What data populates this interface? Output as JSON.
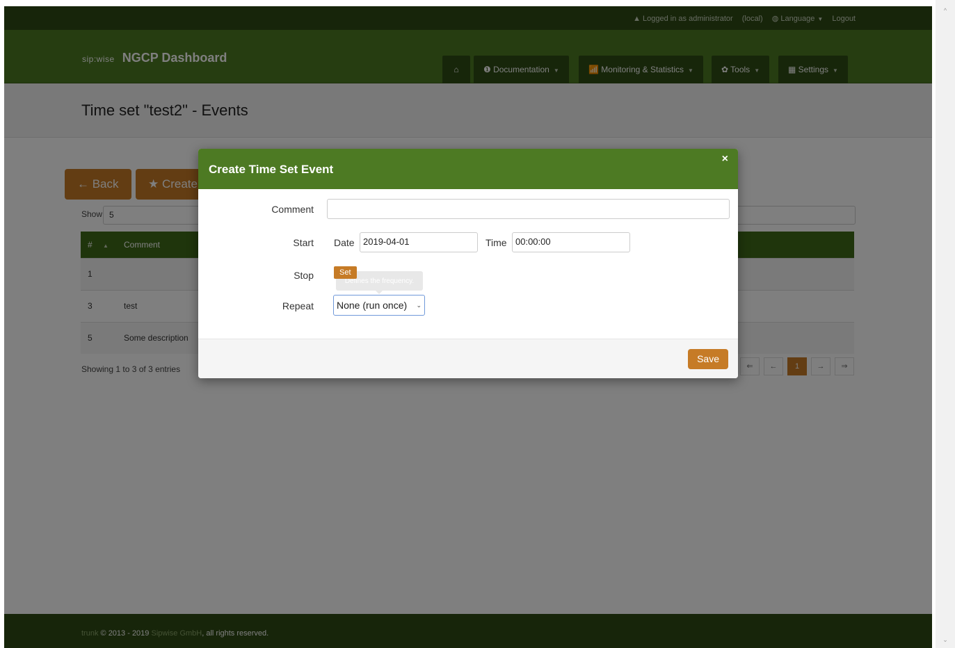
{
  "topbar": {
    "logged_in": "▲ Logged in as administrator",
    "realm": "(local)",
    "language": "◍ Language",
    "logout": "Logout"
  },
  "brand": {
    "logo": "sip:wise",
    "title": "NGCP Dashboard"
  },
  "nav": {
    "home_icon": "home-icon",
    "documentation": "❶ Documentation",
    "monitoring": "📶 Monitoring & Statistics",
    "tools": "✿ Tools",
    "settings": "▦ Settings"
  },
  "header": {
    "title": "Time set \"test2\" - Events"
  },
  "buttons": {
    "back": "← Back",
    "create": "★ Create"
  },
  "table": {
    "show_label": "Show",
    "show_value": "5",
    "columns": [
      "#",
      "Comment"
    ],
    "rows": [
      {
        "id": "1",
        "comment": ""
      },
      {
        "id": "3",
        "comment": "test"
      },
      {
        "id": "5",
        "comment": "Some description"
      }
    ],
    "info": "Showing 1 to 3 of 3 entries",
    "pager": [
      "⇐",
      "←",
      "1",
      "→",
      "⇒"
    ]
  },
  "footer": {
    "trunk": "trunk",
    "copyright": "© 2013 - 2019",
    "company": "Sipwise GmbH",
    "rights": ", all rights reserved."
  },
  "modal": {
    "title": "Create Time Set Event",
    "close": "×",
    "comment_label": "Comment",
    "comment_value": "",
    "start_label": "Start",
    "date_label": "Date",
    "date_value": "2019-04-01",
    "time_label": "Time",
    "time_value": "00:00:00",
    "stop_label": "Stop",
    "set_button": "Set",
    "tooltip": "Defines the frequency.",
    "repeat_label": "Repeat",
    "repeat_value": "None (run once)",
    "save_button": "Save"
  }
}
